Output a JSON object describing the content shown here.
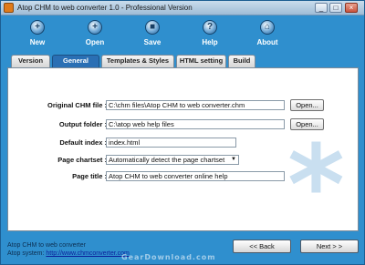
{
  "window": {
    "title": "Atop CHM to web converter 1.0 - Professional Version"
  },
  "toolbar": {
    "buttons": [
      {
        "id": "new",
        "label": "New",
        "glyph": "+"
      },
      {
        "id": "open",
        "label": "Open",
        "glyph": "+"
      },
      {
        "id": "save",
        "label": "Save",
        "glyph": "■"
      },
      {
        "id": "help",
        "label": "Help",
        "glyph": "?"
      },
      {
        "id": "about",
        "label": "About",
        "glyph": "⌂"
      }
    ]
  },
  "tabs": [
    {
      "label": "Version",
      "active": false
    },
    {
      "label": "General",
      "active": true
    },
    {
      "label": "Templates & Styles",
      "active": false
    },
    {
      "label": "HTML setting",
      "active": false
    },
    {
      "label": "Build",
      "active": false
    }
  ],
  "form": {
    "original_chm": {
      "label": "Original CHM file :",
      "value": "C:\\chm files\\Atop CHM to web converter.chm",
      "button": "Open..."
    },
    "output_folder": {
      "label": "Output folder :",
      "value": "C:\\atop web help files",
      "button": "Open..."
    },
    "default_index": {
      "label": "Default index :",
      "value": "index.html"
    },
    "page_charset": {
      "label": "Page chartset :",
      "value": "Automatically detect the page chartset"
    },
    "page_title": {
      "label": "Page title :",
      "value": "Atop CHM to web converter online help"
    }
  },
  "footer": {
    "line1": "Atop CHM to web converter",
    "line2_prefix": "Atop system: ",
    "line2_link": "http://www.chmconverter.com",
    "back_label": "<< Back",
    "next_label": "Next > >",
    "watermark": "GearDownload.com"
  },
  "colors": {
    "background": "#2f8fce",
    "active_tab": "#2a6fb4"
  }
}
